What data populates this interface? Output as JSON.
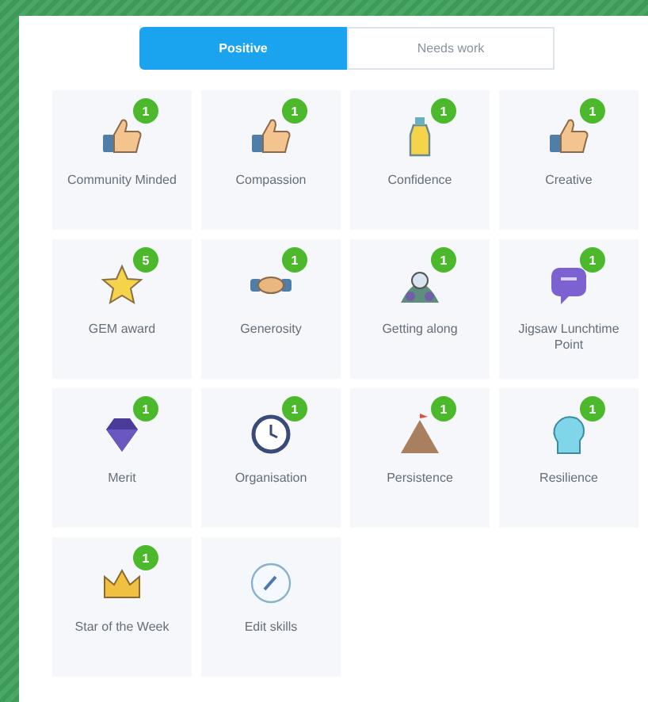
{
  "tabs": [
    {
      "label": "Positive",
      "selected": true
    },
    {
      "label": "Needs work",
      "selected": false
    }
  ],
  "skills": [
    {
      "kind": "thumb",
      "label": "Community Minded",
      "count": "1"
    },
    {
      "kind": "thumb",
      "label": "Compassion",
      "count": "1"
    },
    {
      "kind": "bottle",
      "label": "Confidence",
      "count": "1"
    },
    {
      "kind": "thumb",
      "label": "Creative",
      "count": "1"
    },
    {
      "kind": "star",
      "label": "GEM award",
      "count": "5"
    },
    {
      "kind": "handshake",
      "label": "Generosity",
      "count": "1"
    },
    {
      "kind": "team",
      "label": "Getting along",
      "count": "1"
    },
    {
      "kind": "chat",
      "label": "Jigsaw Lunchtime Point",
      "count": "1"
    },
    {
      "kind": "gem",
      "label": "Merit",
      "count": "1"
    },
    {
      "kind": "clock",
      "label": "Organisation",
      "count": "1"
    },
    {
      "kind": "mountain",
      "label": "Persistence",
      "count": "1"
    },
    {
      "kind": "head",
      "label": "Resilience",
      "count": "1"
    },
    {
      "kind": "crown",
      "label": "Star of the Week",
      "count": "1"
    },
    {
      "kind": "edit",
      "label": "Edit skills"
    }
  ]
}
